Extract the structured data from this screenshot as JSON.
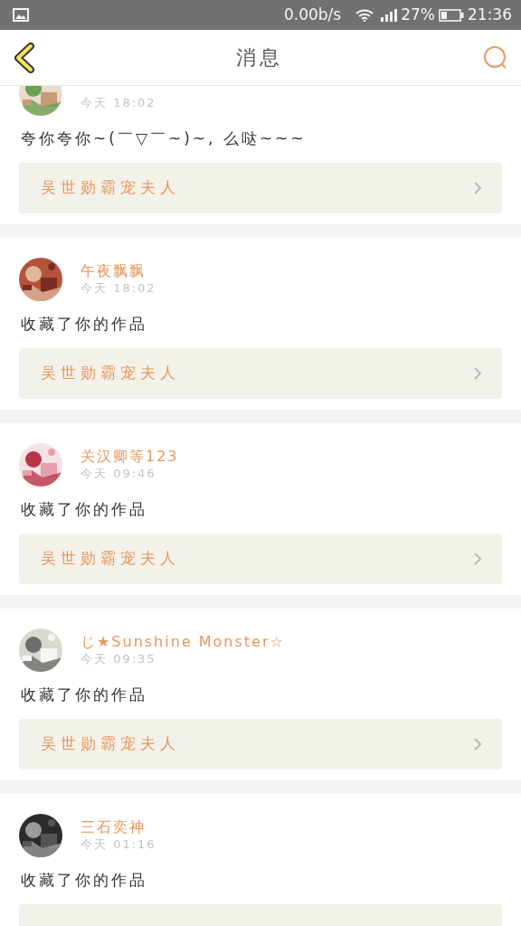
{
  "status_bar": {
    "speed": "0.00b/s",
    "battery": "27%",
    "time": "21:36"
  },
  "header": {
    "title": "消息"
  },
  "messages": [
    {
      "time": "今天 18:02",
      "text": "夸你夸你~(￣▽￣~)~, 么哒~~~",
      "work": "吴世勋霸宠夫人"
    },
    {
      "user": "午夜飘飘",
      "time": "今天 18:02",
      "text": "收藏了你的作品",
      "work": "吴世勋霸宠夫人"
    },
    {
      "user": "关汉卿等123",
      "time": "今天 09:46",
      "text": "收藏了你的作品",
      "work": "吴世勋霸宠夫人"
    },
    {
      "user": "じ★Sunshine Monster☆",
      "time": "今天 09:35",
      "text": "收藏了你的作品",
      "work": "吴世勋霸宠夫人"
    },
    {
      "user": "三石奕神",
      "time": "今天 01:16",
      "text": "收藏了你的作品"
    }
  ]
}
